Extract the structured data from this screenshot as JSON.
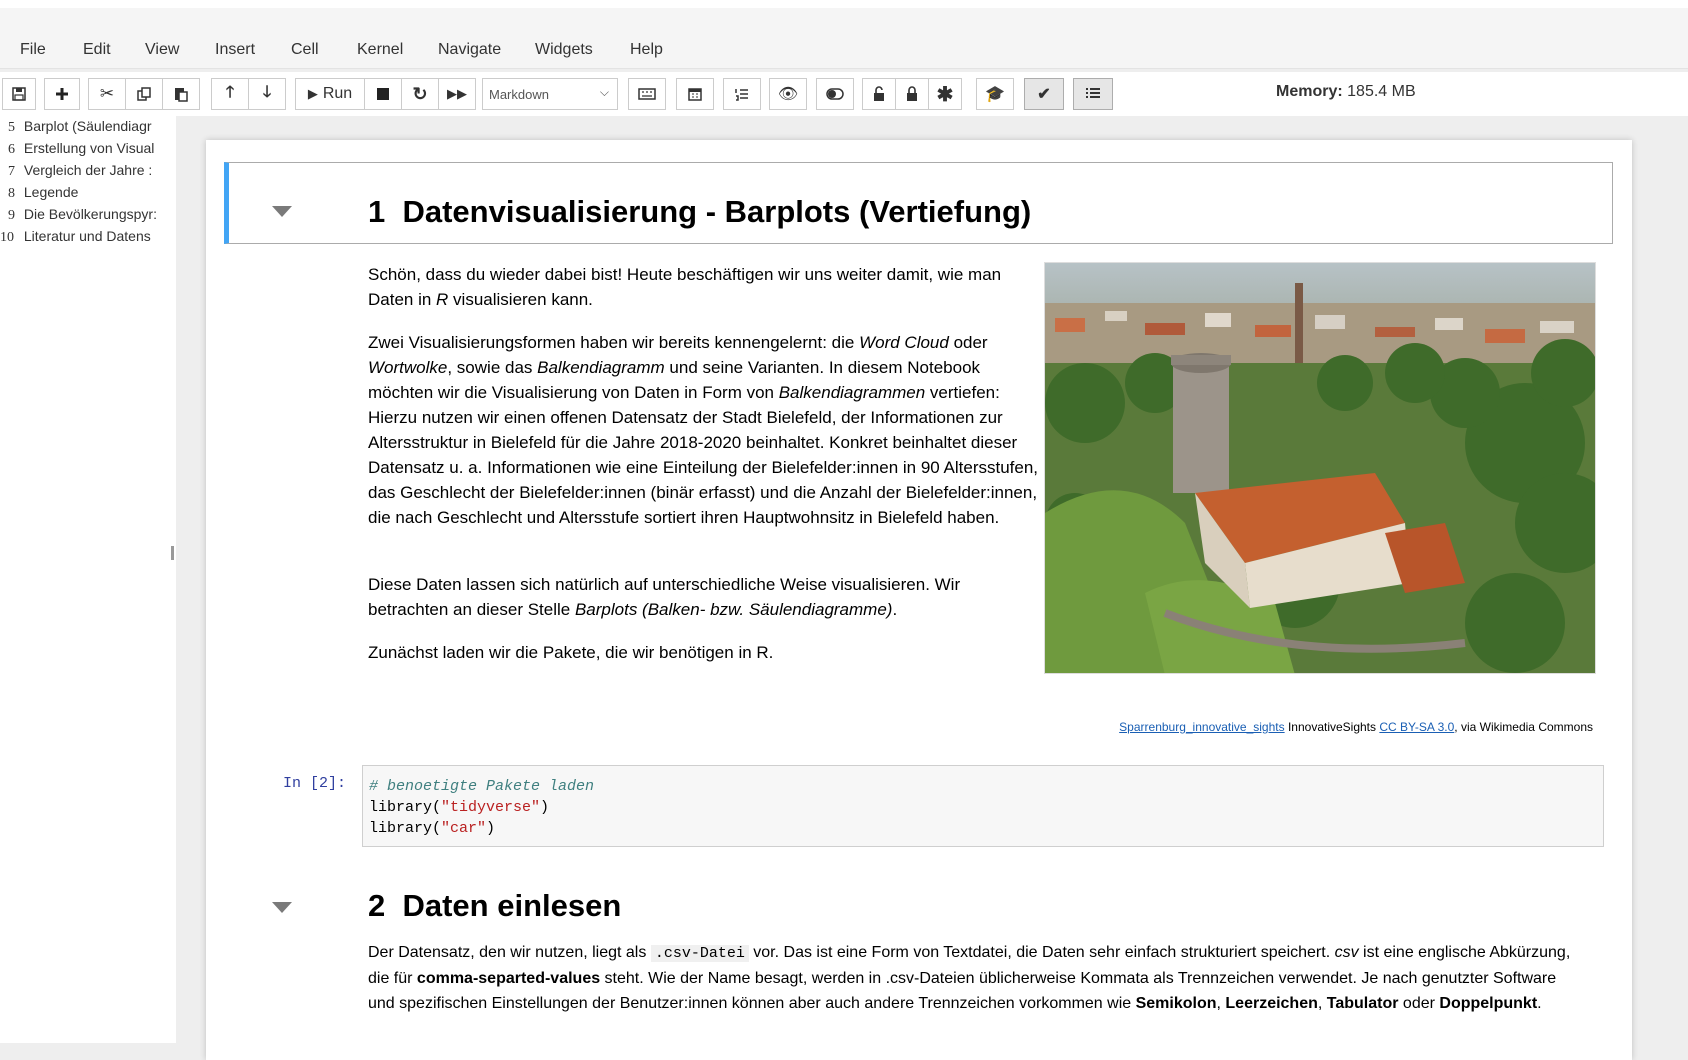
{
  "menu": [
    "File",
    "Edit",
    "View",
    "Insert",
    "Cell",
    "Kernel",
    "Navigate",
    "Widgets",
    "Help"
  ],
  "toolbar": {
    "run_label": "Run",
    "cell_type": "Markdown",
    "memory_label": "Memory:",
    "memory_value": "185.4 MB"
  },
  "icons": [
    "save-icon",
    "plus-icon",
    "cut-icon",
    "copy-icon",
    "paste-icon",
    "arrow-up-icon",
    "arrow-down-icon",
    "run-icon",
    "stop-icon",
    "restart-icon",
    "fast-forward-icon",
    "keyboard-icon",
    "calendar-icon",
    "list-icon",
    "eye-icon",
    "toggle-icon",
    "lock-icon",
    "lock-icon",
    "asterisk-icon",
    "graduation-cap-icon",
    "check-icon",
    "toc-icon"
  ],
  "toc": [
    {
      "num": "5",
      "label": "Barplot (Säulendiagr"
    },
    {
      "num": "6",
      "label": "Erstellung von Visual"
    },
    {
      "num": "7",
      "label": "Vergleich der Jahre :"
    },
    {
      "num": "8",
      "label": "Legende"
    },
    {
      "num": "9",
      "label": "Die Bevölkerungspyr:"
    },
    {
      "num": "10",
      "label": "Literatur und Datens"
    }
  ],
  "section1": {
    "number": "1",
    "title": "Datenvisualisierung - Barplots (Vertiefung)",
    "p1_a": "Schön, dass du wieder dabei bist! Heute beschäftigen wir uns weiter damit, wie man Daten in ",
    "p1_r": "R",
    "p1_b": " visualisieren kann.",
    "p2_a": "Zwei Visualisierungsformen haben wir bereits kennengelernt: die ",
    "p2_wordcloud": "Word Cloud",
    "p2_b": " oder ",
    "p2_wortwolke": "Wortwolke",
    "p2_c": ", sowie das ",
    "p2_balken": "Balkendiagramm",
    "p2_d": " und seine Varianten. In diesem Notebook möchten wir die Visualisierung von Daten in Form von ",
    "p2_balken2": "Balkendiagrammen",
    "p2_e": " vertiefen: Hierzu nutzen wir einen offenen Datensatz der Stadt Bielefeld, der Informationen zur Altersstruktur in Bielefeld für die Jahre 2018-2020 beinhaltet. Konkret beinhaltet dieser Datensatz u. a. Informationen wie eine Einteilung der Bielefelder:innen in 90 Altersstufen, das Geschlecht der Bielefelder:innen (binär erfasst) und die Anzahl der Bielefelder:innen, die nach Geschlecht und Altersstufe sortiert ihren Hauptwohnsitz in Bielefeld haben.",
    "p3_a": "Diese Daten lassen sich natürlich auf unterschiedliche Weise visualisieren. Wir betrachten an dieser Stelle ",
    "p3_barplots": "Barplots (Balken- bzw. Säulendiagramme)",
    "p3_b": ".",
    "p4": "Zunächst laden wir die Pakete, die wir benötigen in R.",
    "attrib_link": "Sparrenburg_innovative_sights",
    "attrib_mid": " InnovativeSights ",
    "attrib_license": "CC BY-SA 3.0",
    "attrib_end": ", via Wikimedia Commons"
  },
  "code_cell": {
    "prompt": "In [2]:",
    "comment": "# benoetigte Pakete laden",
    "line2_fn": "library(",
    "line2_str": "\"tidyverse\"",
    "line2_end": ")",
    "line3_fn": "library(",
    "line3_str": "\"car\"",
    "line3_end": ")"
  },
  "section2": {
    "number": "2",
    "title": "Daten einlesen",
    "t1": "Der Datensatz, den wir nutzen, liegt als ",
    "csv_code": ".csv-Datei",
    "t2": " vor. Das ist eine Form von Textdatei, die Daten sehr einfach strukturiert speichert. ",
    "csv_i": "csv",
    "t3": " ist eine englische Abkürzung, die für ",
    "csv_b": "comma-separted-values",
    "t4": " steht. Wie der Name besagt, werden in .csv-Dateien üblicherweise Kommata als Trennzeichen verwendet. Je nach genutzter Software und spezifischen Einstellungen der Benutzer:innen können aber auch andere Trennzeichen vorkommen wie ",
    "sep1": "Semikolon",
    "c1": ", ",
    "sep2": "Leerzeichen",
    "c2": ", ",
    "sep3": "Tabulator",
    "c3": " oder ",
    "sep4": "Doppelpunkt",
    "c4": "."
  }
}
